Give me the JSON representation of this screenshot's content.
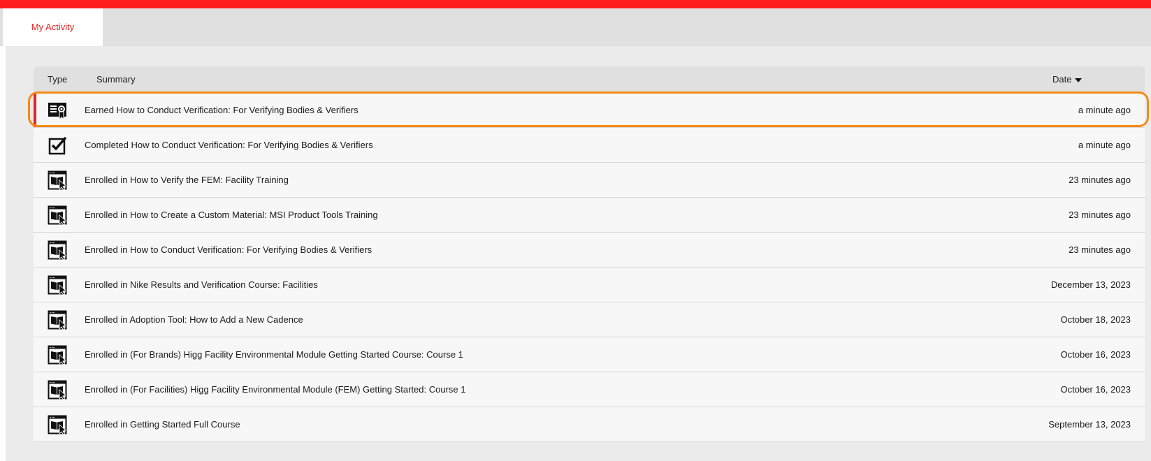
{
  "tabs": {
    "active_label": "My Activity"
  },
  "table": {
    "headers": {
      "type": "Type",
      "summary": "Summary",
      "date": "Date"
    },
    "rows": [
      {
        "icon": "certificate-icon",
        "summary": "Earned How to Conduct Verification: For Verifying Bodies & Verifiers",
        "date": "a minute ago"
      },
      {
        "icon": "checkbox-checked-icon",
        "summary": "Completed How to Conduct Verification: For Verifying Bodies & Verifiers",
        "date": "a minute ago"
      },
      {
        "icon": "course-enroll-icon",
        "summary": "Enrolled in How to Verify the FEM: Facility Training",
        "date": "23 minutes ago"
      },
      {
        "icon": "course-enroll-icon",
        "summary": "Enrolled in How to Create a Custom Material: MSI Product Tools Training",
        "date": "23 minutes ago"
      },
      {
        "icon": "course-enroll-icon",
        "summary": "Enrolled in How to Conduct Verification: For Verifying Bodies & Verifiers",
        "date": "23 minutes ago"
      },
      {
        "icon": "course-enroll-icon",
        "summary": "Enrolled in Nike Results and Verification Course: Facilities",
        "date": "December 13, 2023"
      },
      {
        "icon": "course-enroll-icon",
        "summary": "Enrolled in Adoption Tool: How to Add a New Cadence",
        "date": "October 18, 2023"
      },
      {
        "icon": "course-enroll-icon",
        "summary": "Enrolled in (For Brands) Higg Facility Environmental Module Getting Started Course: Course 1",
        "date": "October 16, 2023"
      },
      {
        "icon": "course-enroll-icon",
        "summary": "Enrolled in (For Facilities) Higg Facility Environmental Module (FEM) Getting Started: Course 1",
        "date": "October 16, 2023"
      },
      {
        "icon": "course-enroll-icon",
        "summary": "Enrolled in Getting Started Full Course",
        "date": "September 13, 2023"
      }
    ]
  },
  "colors": {
    "brand_red": "#ff1e1e",
    "highlight_orange": "#f58a16",
    "tab_text": "#e32626"
  }
}
